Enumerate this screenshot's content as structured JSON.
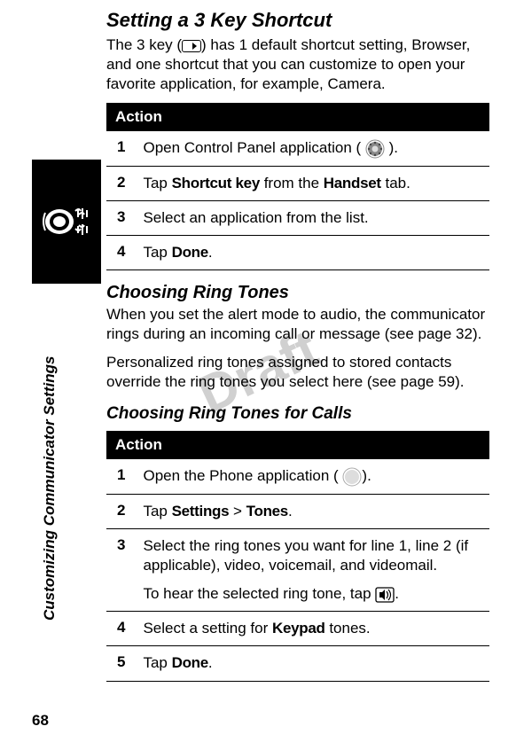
{
  "watermark": "Draft",
  "page_number": "68",
  "sidebar_label": "Customizing Communicator Settings",
  "section1": {
    "title": "Setting a 3 Key Shortcut",
    "intro_pre": "The 3 key (",
    "intro_post": ") has 1 default shortcut setting, Browser, and one shortcut that you can customize to open your favorite application, for example, Camera.",
    "table_header": "Action",
    "steps": [
      {
        "num": "1",
        "pre": "Open Control Panel application (",
        "post": ")."
      },
      {
        "num": "2",
        "pre": "Tap ",
        "b1": "Shortcut key",
        "mid": " from the ",
        "b2": "Handset",
        "post": " tab."
      },
      {
        "num": "3",
        "text": "Select an application from the list."
      },
      {
        "num": "4",
        "pre": "Tap ",
        "b1": "Done",
        "post": "."
      }
    ]
  },
  "section2": {
    "title": "Choosing Ring Tones",
    "para1": "When you set the alert mode to audio, the communicator rings during an incoming call or message (see page 32).",
    "para2": "Personalized ring tones assigned to stored contacts override the ring tones you select here (see page 59)."
  },
  "section3": {
    "title": "Choosing Ring Tones for Calls",
    "table_header": "Action",
    "steps": [
      {
        "num": "1",
        "pre": "Open the Phone application (",
        "post": ")."
      },
      {
        "num": "2",
        "pre": "Tap ",
        "b1": "Settings",
        "mid": " > ",
        "b2": "Tones",
        "post": "."
      },
      {
        "num": "3",
        "text": "Select the ring tones you want for line 1, line 2 (if applicable), video, voicemail, and videomail.",
        "sub_pre": "To hear the selected ring tone, tap ",
        "sub_post": "."
      },
      {
        "num": "4",
        "pre": "Select a setting for ",
        "b1": "Keypad",
        "post": " tones."
      },
      {
        "num": "5",
        "pre": "Tap ",
        "b1": "Done",
        "post": "."
      }
    ]
  }
}
